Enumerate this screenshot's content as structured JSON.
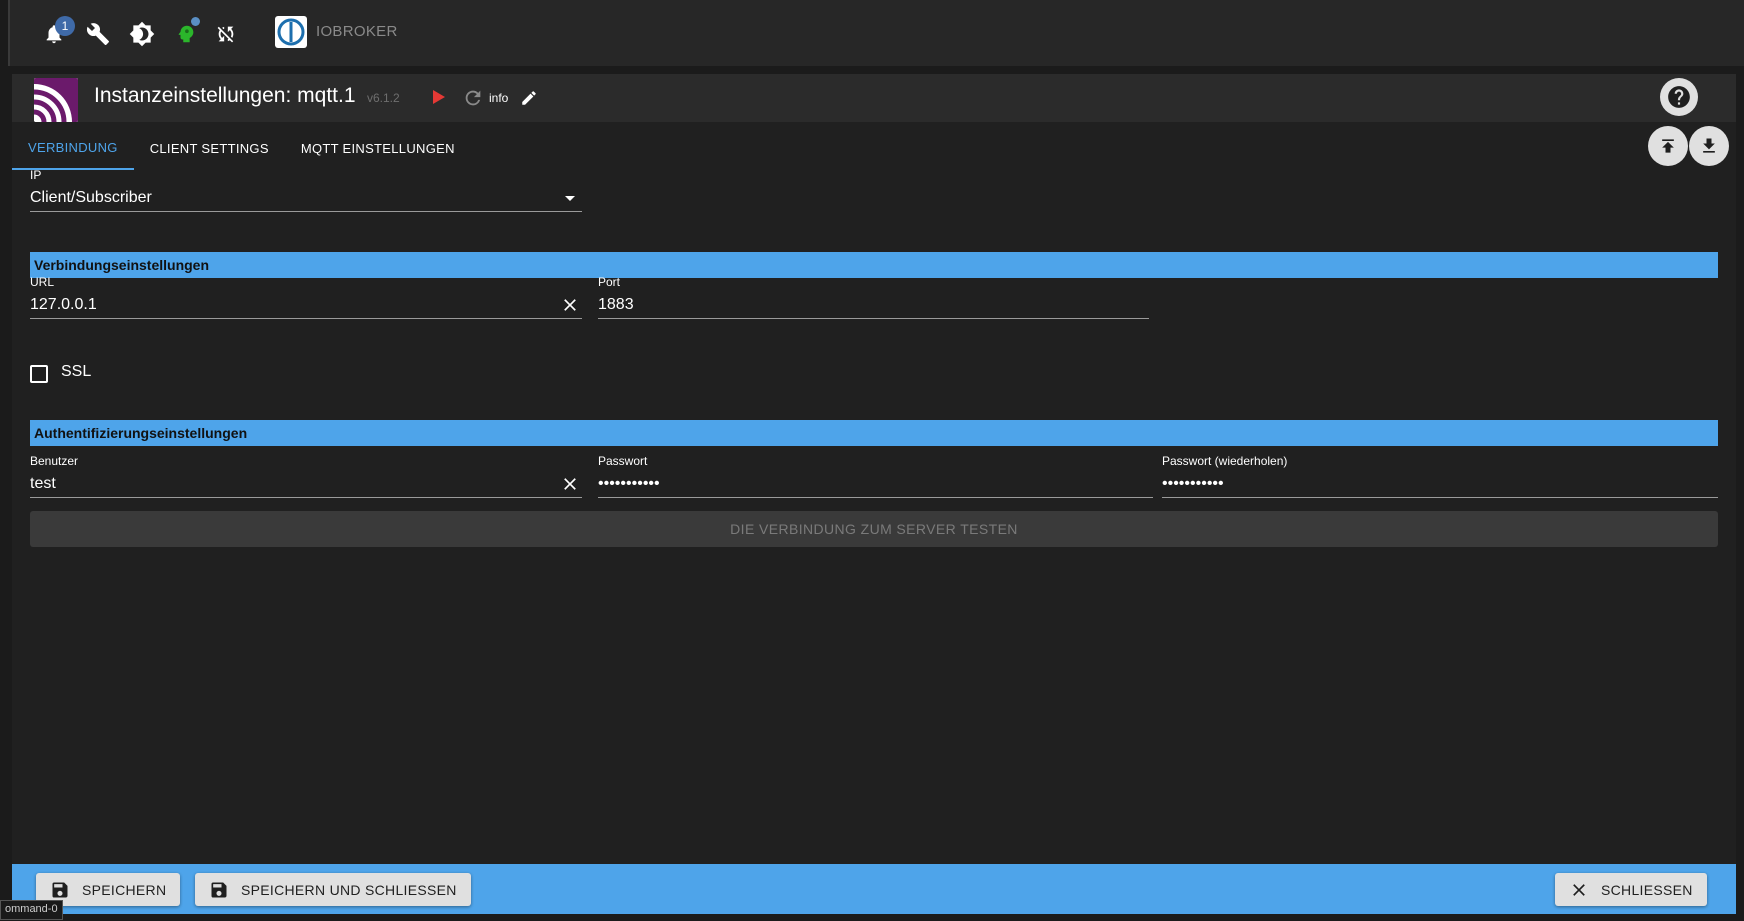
{
  "topbar": {
    "notification_count": "1",
    "brand": "IOBROKER"
  },
  "dialog": {
    "title": "Instanzeinstellungen: mqtt.1",
    "version": "v6.1.2",
    "info_label": "info"
  },
  "tabs": [
    {
      "label": "VERBINDUNG",
      "active": true
    },
    {
      "label": "CLIENT SETTINGS",
      "active": false
    },
    {
      "label": "MQTT EINSTELLUNGEN",
      "active": false
    }
  ],
  "form": {
    "ip_label": "IP",
    "ip_value": "Client/Subscriber",
    "connection_section": "Verbindungseinstellungen",
    "url_label": "URL",
    "url_value": "127.0.0.1",
    "port_label": "Port",
    "port_value": "1883",
    "ssl_label": "SSL",
    "ssl_checked": false,
    "auth_section": "Authentifizierungseinstellungen",
    "user_label": "Benutzer",
    "user_value": "test",
    "password_label": "Passwort",
    "password_value": "•••••••••••",
    "password_repeat_label": "Passwort (wiederholen)",
    "password_repeat_value": "•••••••••••",
    "test_button": "DIE VERBINDUNG ZUM SERVER TESTEN"
  },
  "footer": {
    "save_label": "SPEICHERN",
    "save_close_label": "SPEICHERN UND SCHLIESSEN",
    "close_label": "SCHLIESSEN"
  },
  "status": {
    "command_tag": "ommand-0"
  },
  "colors": {
    "accent": "#4ea4ea",
    "background": "#202020",
    "header": "#2b2b2b",
    "play": "#e53935",
    "brand_purple": "#6b1a6b",
    "online": "#2bb62b"
  },
  "icons": [
    "bell-icon",
    "wrench-icon",
    "brightness-icon",
    "expert-head-icon",
    "sync-off-icon",
    "iobroker-logo",
    "mqtt-logo",
    "play-icon",
    "reload-icon",
    "pencil-icon",
    "help-icon",
    "upload-icon",
    "download-icon",
    "chevron-down-icon",
    "clear-icon",
    "save-icon",
    "close-icon"
  ]
}
